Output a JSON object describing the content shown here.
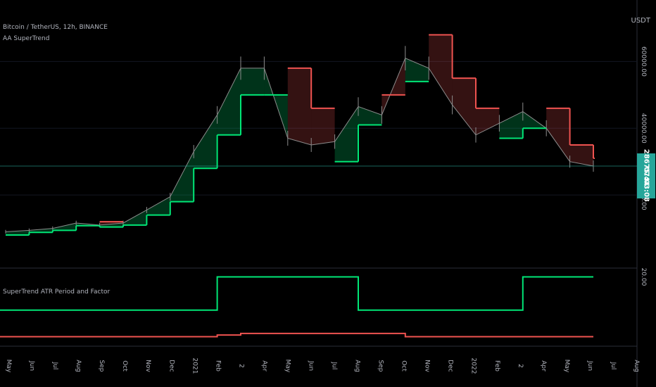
{
  "header": {
    "symbol": "Bitcoin / TetherUS, 12h, BINANCE",
    "indicator": "AA SuperTrend",
    "sub_indicator": "SuperTrend ATR Period and Factor"
  },
  "price_axis": {
    "unit": "USDT",
    "labels": [
      "60000.00",
      "40000.00",
      "20000.00"
    ],
    "current_price": "28675.44",
    "countdown": "07:03:08"
  },
  "sub_axis": {
    "labels": [
      "20.00"
    ]
  },
  "time_axis": {
    "labels": [
      "May",
      "Jun",
      "Jul",
      "Aug",
      "Sep",
      "Oct",
      "Nov",
      "Dec",
      "2021",
      "Feb",
      "2",
      "Apr",
      "May",
      "Jun",
      "Jul",
      "Aug",
      "Sep",
      "Oct",
      "Nov",
      "Dec",
      "2022",
      "Feb",
      "2",
      "Apr",
      "May",
      "Jun",
      "Jul",
      "Aug"
    ]
  },
  "colors": {
    "background": "#000000",
    "up": "#00e676",
    "down": "#ef5350",
    "candle": "#8c8c8c",
    "price_line": "#26a69a",
    "text": "#b2b5be"
  },
  "chart_data": [
    {
      "type": "line",
      "title": "Bitcoin / TetherUS, 12h, BINANCE",
      "x": [
        "2020-05",
        "2020-06",
        "2020-07",
        "2020-08",
        "2020-09",
        "2020-10",
        "2020-11",
        "2020-12",
        "2021-01",
        "2021-02",
        "2021-03",
        "2021-04",
        "2021-05",
        "2021-06",
        "2021-07",
        "2021-08",
        "2021-09",
        "2021-10",
        "2021-11",
        "2021-12",
        "2022-01",
        "2022-02",
        "2022-03",
        "2022-04",
        "2022-05",
        "2022-06"
      ],
      "y_label": "USDT",
      "ylim": [
        0,
        70000
      ],
      "series": [
        {
          "name": "",
          "kind": "price",
          "values": [
            9000,
            9400,
            10000,
            11600,
            11000,
            11600,
            15500,
            19500,
            33000,
            44000,
            58000,
            58000,
            37000,
            35000,
            36000,
            46500,
            44000,
            61000,
            58000,
            47000,
            38000,
            41500,
            45000,
            40000,
            30000,
            28675
          ]
        },
        {
          "name": "",
          "kind": "supertrend-up",
          "values": [
            8000,
            8800,
            9400,
            10800,
            10400,
            11000,
            14000,
            18000,
            28000,
            38000,
            50000,
            50000,
            null,
            null,
            30000,
            41000,
            null,
            54000,
            null,
            null,
            null,
            37000,
            40000,
            null,
            null,
            null
          ]
        },
        {
          "name": "",
          "kind": "supertrend-down",
          "values": [
            null,
            null,
            null,
            null,
            12000,
            null,
            null,
            null,
            null,
            null,
            null,
            null,
            58000,
            46000,
            null,
            null,
            50000,
            null,
            68000,
            55000,
            46000,
            null,
            null,
            46000,
            35000,
            31000
          ]
        }
      ]
    },
    {
      "type": "line",
      "title": "SuperTrend ATR Period and Factor",
      "ylim": [
        0,
        22
      ],
      "series": [
        {
          "name": "",
          "kind": "atr-period",
          "values": [
            10,
            10,
            10,
            10,
            10,
            10,
            10,
            10,
            10,
            20,
            20,
            20,
            20,
            20,
            20,
            10,
            10,
            10,
            10,
            10,
            10,
            10,
            20,
            20,
            20,
            20
          ]
        },
        {
          "name": "",
          "kind": "factor",
          "values": [
            2,
            2,
            2,
            2,
            2,
            2,
            2,
            2,
            2,
            2.5,
            3,
            3,
            3,
            3,
            3,
            3,
            3,
            2,
            2,
            2,
            2,
            2,
            2,
            2,
            2,
            2
          ]
        }
      ]
    }
  ]
}
